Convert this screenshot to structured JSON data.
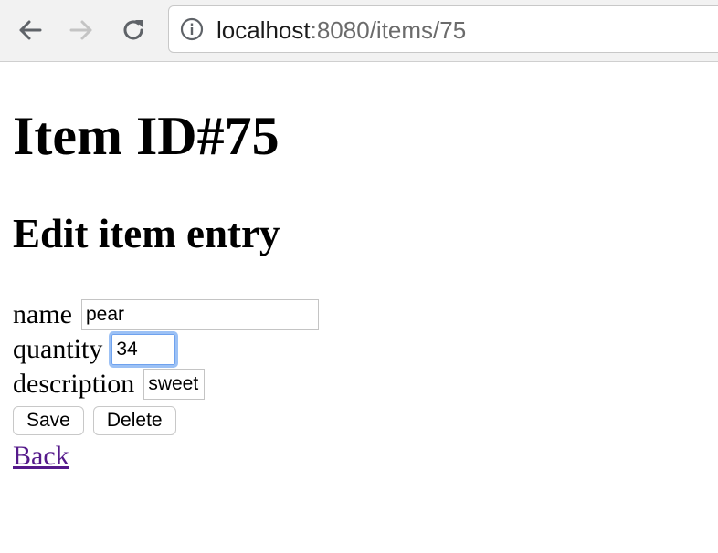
{
  "browser": {
    "url_host": "localhost",
    "url_rest": ":8080/items/75"
  },
  "page": {
    "title": "Item ID#75",
    "subtitle": "Edit item entry"
  },
  "form": {
    "name_label": "name",
    "name_value": "pear",
    "quantity_label": "quantity",
    "quantity_value": "34",
    "description_label": "description",
    "description_value": "sweet",
    "save_label": "Save",
    "delete_label": "Delete"
  },
  "links": {
    "back_label": "Back"
  }
}
